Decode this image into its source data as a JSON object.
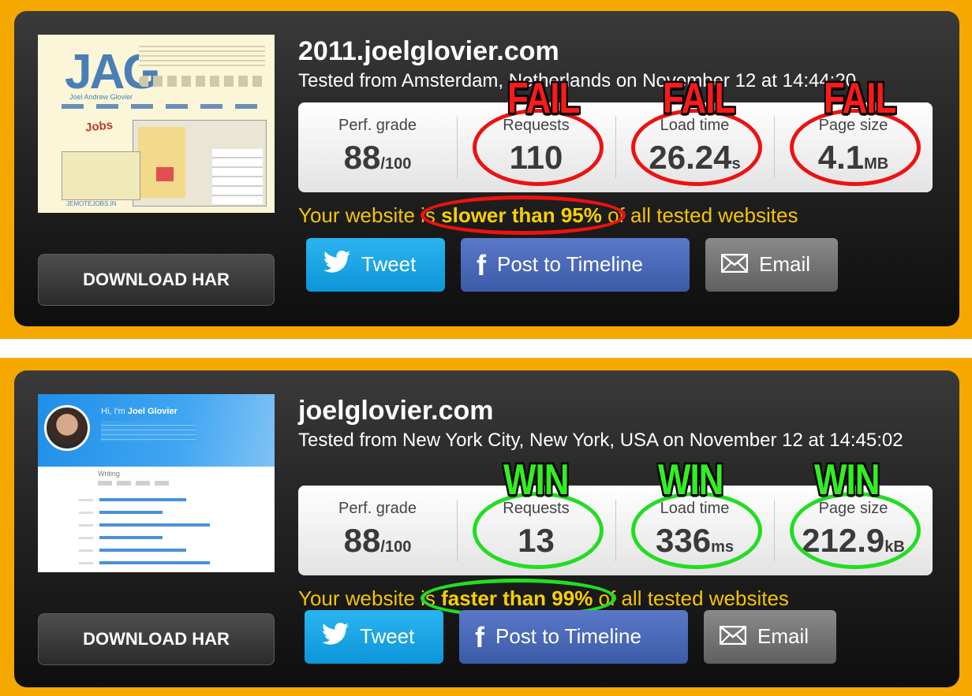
{
  "top": {
    "site": "2011.joelglovier.com",
    "tested": "Tested from Amsterdam, Netherlands on November 12 at 14:44:20",
    "download_label": "DOWNLOAD HAR",
    "metrics": {
      "perf": {
        "label": "Perf. grade",
        "value": "88",
        "unit": "/100"
      },
      "requests": {
        "label": "Requests",
        "value": "110",
        "unit": ""
      },
      "load": {
        "label": "Load time",
        "value": "26.24",
        "unit": "s"
      },
      "size": {
        "label": "Page size",
        "value": "4.1",
        "unit": "MB"
      }
    },
    "verdicts": [
      "FAIL",
      "FAIL",
      "FAIL"
    ],
    "summary": {
      "pre": "Your website is ",
      "highlight": "slower than 95%",
      "post": " of all tested websites"
    },
    "share": {
      "tweet": "Tweet",
      "facebook": "Post to Timeline",
      "email": "Email"
    },
    "thumb": {
      "logo": "JAG",
      "subtitle": "Joel Andrew Glovier",
      "jobs": "Jobs",
      "footer": "JEMOTEJOBS.IN"
    }
  },
  "bottom": {
    "site": "joelglovier.com",
    "tested": "Tested from New York City, New York, USA on November 12 at 14:45:02",
    "download_label": "DOWNLOAD HAR",
    "metrics": {
      "perf": {
        "label": "Perf. grade",
        "value": "88",
        "unit": "/100"
      },
      "requests": {
        "label": "Requests",
        "value": "13",
        "unit": ""
      },
      "load": {
        "label": "Load time",
        "value": "336",
        "unit": "ms"
      },
      "size": {
        "label": "Page size",
        "value": "212.9",
        "unit": "kB"
      }
    },
    "verdicts": [
      "WIN",
      "WIN",
      "WIN"
    ],
    "summary": {
      "pre": "Your website is ",
      "highlight": "faster than 99%",
      "post": " of all tested websites"
    },
    "share": {
      "tweet": "Tweet",
      "facebook": "Post to Timeline",
      "email": "Email"
    },
    "thumb": {
      "greeting_pre": "Hi, I'm ",
      "greeting_name": "Joel Glovier",
      "section": "Writing"
    }
  },
  "colors": {
    "band": "#f5a800",
    "fail": "#ee1111",
    "win": "#22dd22",
    "summary_text": "#f5c400",
    "tweet": "#1da1e8",
    "facebook": "#4a69b8",
    "email": "#7a7a7a"
  },
  "icons": {
    "tweet": "twitter-bird-icon",
    "facebook": "facebook-f-icon",
    "email": "envelope-icon"
  }
}
